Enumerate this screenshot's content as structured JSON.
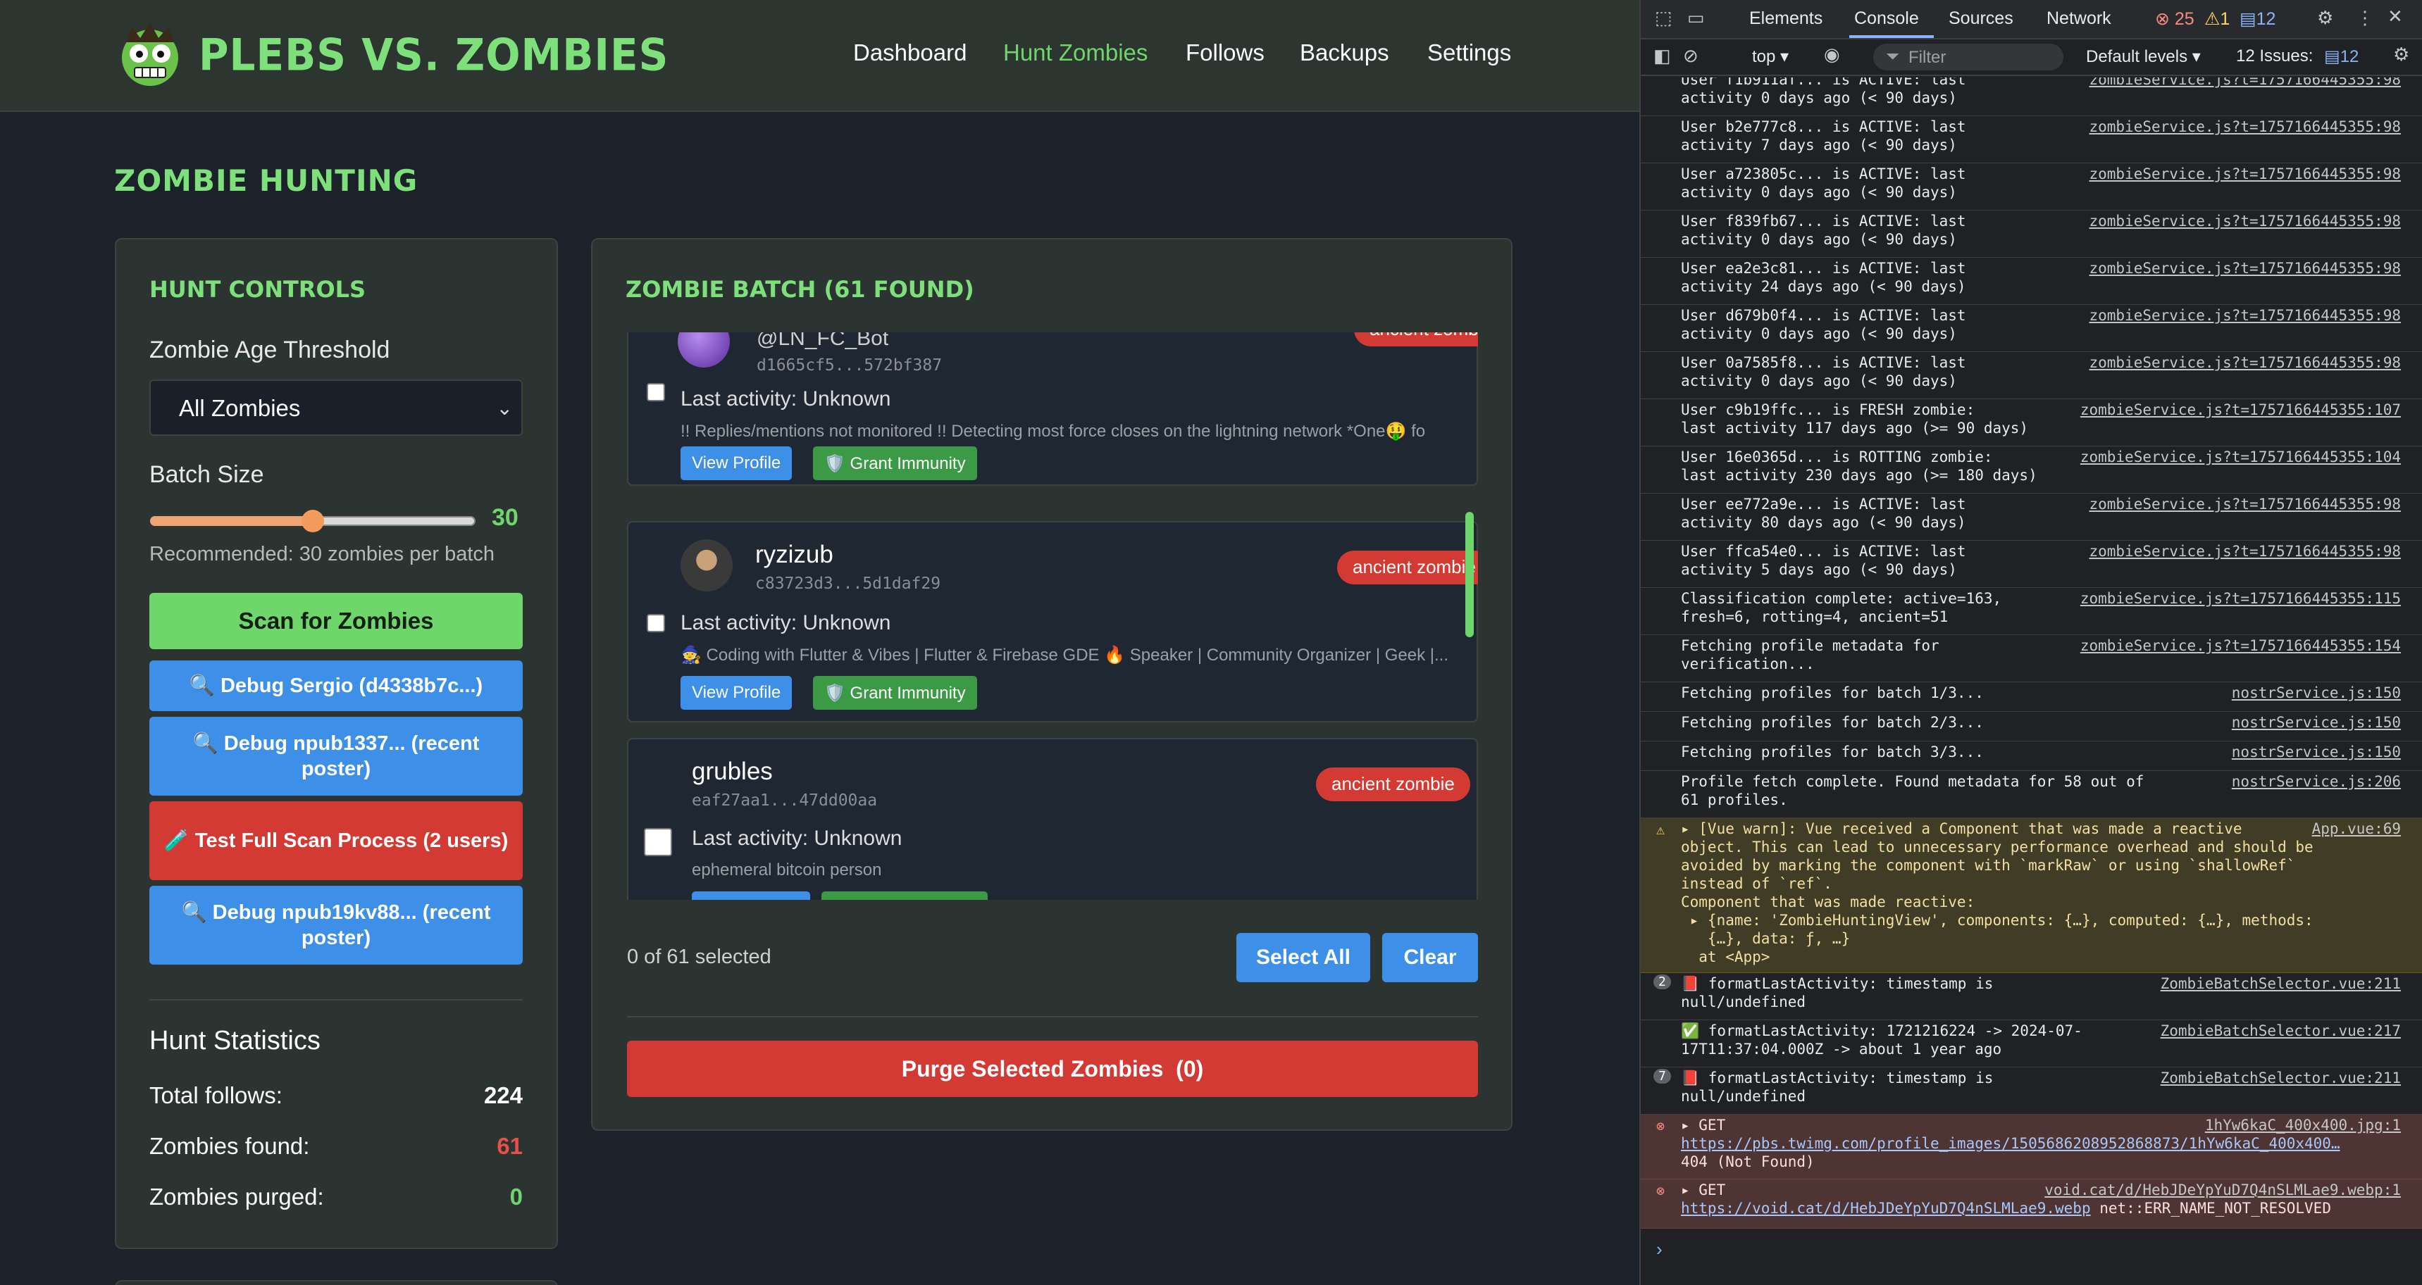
{
  "app": {
    "brand": "PLEBS VS. ZOMBIES",
    "nav": [
      "Dashboard",
      "Hunt Zombies",
      "Follows",
      "Backups",
      "Settings"
    ],
    "nav_active": "Hunt Zombies",
    "page_title": "ZOMBIE HUNTING"
  },
  "controls": {
    "title": "HUNT CONTROLS",
    "age_label": "Zombie Age Threshold",
    "age_value": "All Zombies",
    "batch_label": "Batch Size",
    "batch_value": "30",
    "batch_fraction": 0.5,
    "hint": "Recommended: 30 zombies per batch",
    "scan_button": "Scan for Zombies",
    "debug_buttons": [
      "🔍 Debug Sergio (d4338b7c...)",
      "🔍 Debug npub1337... (recent poster)",
      "🧪 Test Full Scan Process (2 users)",
      "🔍 Debug npub19kv88... (recent poster)"
    ]
  },
  "stats": {
    "title": "Hunt Statistics",
    "total_follows_label": "Total follows:",
    "total_follows": "224",
    "zombies_found_label": "Zombies found:",
    "zombies_found": "61",
    "zombies_purged_label": "Zombies purged:",
    "zombies_purged": "0"
  },
  "batch": {
    "title": "ZOMBIE BATCH (61 FOUND)",
    "items": [
      {
        "name": "@LN_FC_Bot",
        "npub": "d1665cf5...572bf387",
        "activity": "Last activity: Unknown",
        "about": "!! Replies/mentions not monitored !! Detecting most force closes on the lightning network *One🤑 fo",
        "badge": "ancient zombie",
        "view": "View Profile",
        "immunity": "🛡️ Grant Immunity"
      },
      {
        "name": "ryzizub",
        "npub": "c83723d3...5d1daf29",
        "activity": "Last activity: Unknown",
        "about": "🧙 Coding with Flutter & Vibes | Flutter & Firebase GDE 🔥 Speaker | Community Organizer | Geek |...",
        "badge": "ancient zombie",
        "view": "View Profile",
        "immunity": "🛡️ Grant Immunity"
      },
      {
        "name": "grubles",
        "npub": "eaf27aa1...47dd00aa",
        "activity": "Last activity: Unknown",
        "about": "ephemeral bitcoin person",
        "badge": "ancient zombie"
      }
    ],
    "selected_text": "0 of 61 selected",
    "select_all": "Select All",
    "clear": "Clear",
    "purge": "Purge Selected Zombies  (0)"
  },
  "devtools": {
    "tabs": [
      "Elements",
      "Console",
      "Sources",
      "Network"
    ],
    "active_tab": "Console",
    "errors": "25",
    "warnings": "1",
    "issues_badge": "12",
    "context": "top ▾",
    "filter_placeholder": "Filter",
    "levels": "Default levels ▾",
    "issues_label": "12 Issues:",
    "issues_count": "12",
    "logs": [
      {
        "msg": "User f1b911af... is ACTIVE: last\nactivity 0 days ago (< 90 days)",
        "src": "zombieService.js?t=1757166445355:98"
      },
      {
        "msg": "User b2e777c8... is ACTIVE: last\nactivity 7 days ago (< 90 days)",
        "src": "zombieService.js?t=1757166445355:98"
      },
      {
        "msg": "User a723805c... is ACTIVE: last\nactivity 0 days ago (< 90 days)",
        "src": "zombieService.js?t=1757166445355:98"
      },
      {
        "msg": "User f839fb67... is ACTIVE: last\nactivity 0 days ago (< 90 days)",
        "src": "zombieService.js?t=1757166445355:98"
      },
      {
        "msg": "User ea2e3c81... is ACTIVE: last\nactivity 24 days ago (< 90 days)",
        "src": "zombieService.js?t=1757166445355:98"
      },
      {
        "msg": "User d679b0f4... is ACTIVE: last\nactivity 0 days ago (< 90 days)",
        "src": "zombieService.js?t=1757166445355:98"
      },
      {
        "msg": "User 0a7585f8... is ACTIVE: last\nactivity 0 days ago (< 90 days)",
        "src": "zombieService.js?t=1757166445355:98"
      },
      {
        "msg": "User c9b19ffc... is FRESH zombie:\nlast activity 117 days ago (>= 90 days)",
        "src": "zombieService.js?t=1757166445355:107"
      },
      {
        "msg": "User 16e0365d... is ROTTING zombie:\nlast activity 230 days ago (>= 180 days)",
        "src": "zombieService.js?t=1757166445355:104"
      },
      {
        "msg": "User ee772a9e... is ACTIVE: last\nactivity 80 days ago (< 90 days)",
        "src": "zombieService.js?t=1757166445355:98"
      },
      {
        "msg": "User ffca54e0... is ACTIVE: last\nactivity 5 days ago (< 90 days)",
        "src": "zombieService.js?t=1757166445355:98"
      },
      {
        "msg": "Classification complete: active=163,\nfresh=6, rotting=4, ancient=51",
        "src": "zombieService.js?t=1757166445355:115"
      },
      {
        "msg": "Fetching profile metadata for\nverification...",
        "src": "zombieService.js?t=1757166445355:154"
      },
      {
        "msg": "Fetching profiles for batch 1/3...",
        "src": "nostrService.js:150"
      },
      {
        "msg": "Fetching profiles for batch 2/3...",
        "src": "nostrService.js:150"
      },
      {
        "msg": "Fetching profiles for batch 3/3...",
        "src": "nostrService.js:150"
      },
      {
        "msg": "Profile fetch complete. Found metadata for 58 out of\n61 profiles.",
        "src": "nostrService.js:206"
      }
    ],
    "warn": {
      "msg": "▸ [Vue warn]: Vue received a Component that was made a reactive\nobject. This can lead to unnecessary performance overhead and should be\navoided by marking the component with `markRaw` or using `shallowRef`\ninstead of `ref`.\nComponent that was made reactive:\n ▸ {name: 'ZombieHuntingView', components: {…}, computed: {…}, methods:\n   {…}, data: ƒ, …}\n  at <App>",
      "src": "App.vue:69"
    },
    "logs2": [
      {
        "count": "2",
        "msg": "📕 formatLastActivity: timestamp is\nnull/undefined",
        "src": "ZombieBatchSelector.vue:211"
      },
      {
        "count": "",
        "msg": "✅ formatLastActivity: 1721216224 -> 2024-07-\n17T11:37:04.000Z -> about 1 year ago",
        "src": "ZombieBatchSelector.vue:217"
      },
      {
        "count": "7",
        "msg": "📕 formatLastActivity: timestamp is\nnull/undefined",
        "src": "ZombieBatchSelector.vue:211"
      }
    ],
    "errors_list": [
      {
        "head": "▸ GET",
        "src": "1hYw6kaC_400x400.jpg:1",
        "url": "https://pbs.twimg.com/profile_images/1505686208952868873/1hYw6kaC_400x400…",
        "tail": "404 (Not Found)"
      },
      {
        "head": "▸ GET",
        "src": "void.cat/d/HebJDeYpYuD7Q4nSLMLae9.webp:1",
        "url": "https://void.cat/d/HebJDeYpYuD7Q4nSLMLae9.webp",
        "tail": " net::ERR_NAME_NOT_RESOLVED"
      }
    ],
    "prompt": "›"
  },
  "colors": {
    "accent_green": "#6fd66b",
    "danger_red": "#d23a33",
    "primary_blue": "#3d8fe8"
  }
}
